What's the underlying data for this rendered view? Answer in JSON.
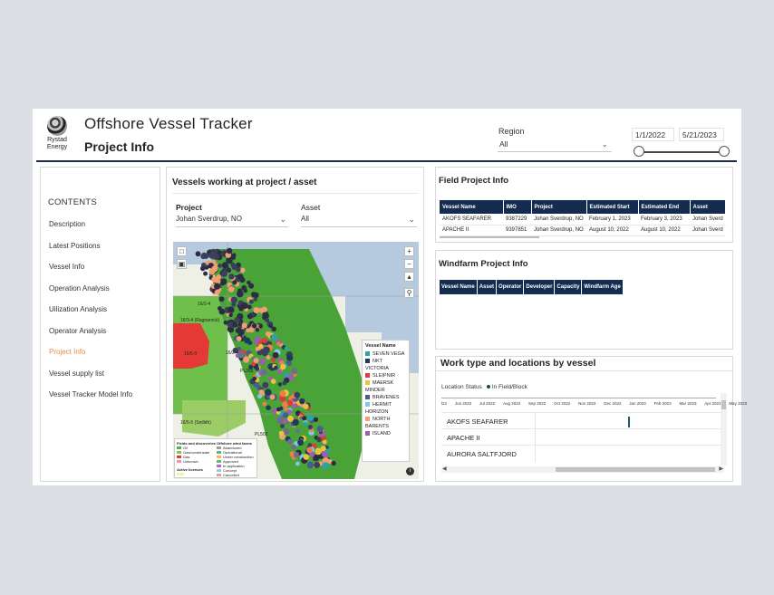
{
  "header": {
    "logo_text": "Rystad Energy",
    "logo_line1": "Rystad",
    "logo_line2": "Energy",
    "app_title": "Offshore Vessel Tracker",
    "page_title": "Project Info",
    "region_label": "Region",
    "region_value": "All",
    "date_start": "1/1/2022",
    "date_end": "5/21/2023",
    "date_range_fill": 1.0
  },
  "sidebar": {
    "title": "CONTENTS",
    "items": [
      {
        "label": "Description",
        "active": false
      },
      {
        "label": "Latest Positions",
        "active": false
      },
      {
        "label": "Vessel Info",
        "active": false
      },
      {
        "label": "Operation Analysis",
        "active": false
      },
      {
        "label": "Uilization Analysis",
        "active": false
      },
      {
        "label": "Operator Analysis",
        "active": false
      },
      {
        "label": "Project Info",
        "active": true
      },
      {
        "label": "Vessel supply list",
        "active": false
      },
      {
        "label": "Vessel Tracker Model Info",
        "active": false
      }
    ]
  },
  "vessels_panel": {
    "title": "Vessels working at project / asset",
    "project_label": "Project",
    "project_value": "Johan Sverdrup, NO",
    "asset_label": "Asset",
    "asset_value": "All",
    "map_labels": [
      "16/3-4 (Ragnarock)",
      "16/2-4",
      "16/2-4",
      "16/5-0",
      "16/5-5 (Snilldh)",
      "PL265",
      "PL502"
    ],
    "legend": {
      "title": "Vessel Name",
      "items": [
        {
          "label": "SEVEN VEGA",
          "color": "#2ba3a8"
        },
        {
          "label": "NKT",
          "color": "#1f3b57"
        },
        {
          "label": "VICTORIA",
          "color": null
        },
        {
          "label": "SLEIPNIR",
          "color": "#e03a3a"
        },
        {
          "label": "MAERSK",
          "color": "#e8c43a"
        },
        {
          "label": "MINDER",
          "color": null
        },
        {
          "label": "BRAVENES",
          "color": "#4a5c8a"
        },
        {
          "label": "HERMIT",
          "color": "#7fc8e6"
        },
        {
          "label": "HORIZON",
          "color": null
        },
        {
          "label": "NORTH",
          "color": "#f0a070"
        },
        {
          "label": "BARENTS",
          "color": null
        },
        {
          "label": "ISLAND",
          "color": "#a05cb0"
        }
      ]
    },
    "map_key": {
      "fields_title": "Fields and discoveries",
      "fields": [
        {
          "label": "Oil",
          "color": "#4caf50"
        },
        {
          "label": "Gas/condensate",
          "color": "#8bc34a"
        },
        {
          "label": "Gas",
          "color": "#e53935"
        },
        {
          "label": "Unknown",
          "color": "#f48fb1"
        }
      ],
      "licences_title": "Active licenses",
      "wind_title": "Offshore wind farms",
      "wind": [
        {
          "label": "Abandoned",
          "color": "#9e9e9e"
        },
        {
          "label": "Operational",
          "color": "#4db6ac"
        },
        {
          "label": "Under construction",
          "color": "#ffb74d"
        },
        {
          "label": "Approved",
          "color": "#66bb6a"
        },
        {
          "label": "In application",
          "color": "#ba68c8"
        },
        {
          "label": "Concept",
          "color": "#90caf9"
        },
        {
          "label": "Cancelled",
          "color": "#ef9a9a"
        }
      ]
    }
  },
  "field_project": {
    "title": "Field Project Info",
    "columns": [
      "Vessel Name",
      "IMO",
      "Project",
      "Estimated Start",
      "Estimated End",
      "Asset"
    ],
    "rows": [
      [
        "AKOFS SEAFARER",
        "9387229",
        "Johan Sverdrup, NO",
        "February 1, 2023",
        "February 3, 2023",
        "Johan Sverd"
      ],
      [
        "APACHE II",
        "9397851",
        "Johan Sverdrup, NO",
        "August 10, 2022",
        "August 10, 2022",
        "Johan Sverd"
      ]
    ]
  },
  "windfarm_project": {
    "title": "Windfarm Project Info",
    "columns": [
      "Vessel Name",
      "Asset",
      "Operator",
      "Developer",
      "Capacity",
      "Windfarm Age"
    ]
  },
  "work_type": {
    "title": "Work type and locations by vessel",
    "location_status_label": "Location Status",
    "status_item": "In Field/Block",
    "months": [
      "l22",
      "Jun 2022",
      "Jul 2022",
      "Aug 2022",
      "Sep 2022",
      "Oct 2022",
      "Nov 2022",
      "Dec 2022",
      "Jan 2023",
      "Feb 2023",
      "Mar 2023",
      "Apr 2023",
      "May 2023"
    ],
    "vessels": [
      "AKOFS SEAFARER",
      "APACHE II",
      "AURORA SALTFJORD"
    ]
  },
  "colors": {
    "header_rule": "#1f2a44",
    "table_header": "#142c4f",
    "nav_active": "#e68a4f",
    "in_field": "#164a54"
  }
}
